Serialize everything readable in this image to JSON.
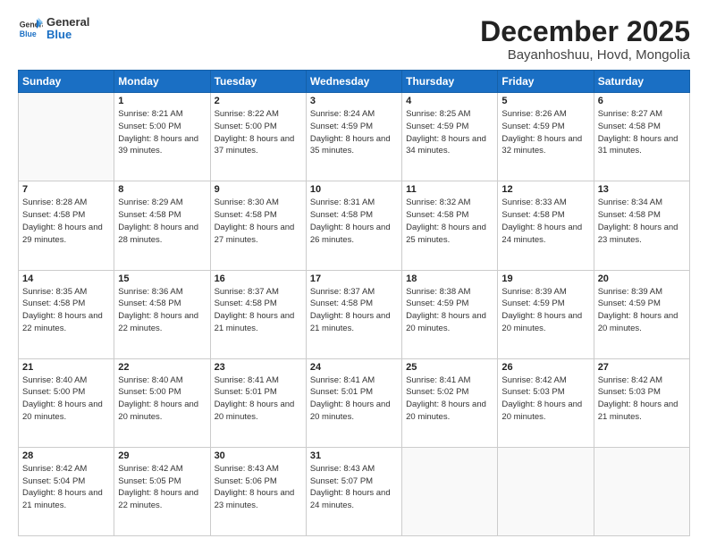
{
  "header": {
    "logo": {
      "general": "General",
      "blue": "Blue"
    },
    "title": "December 2025",
    "location": "Bayanhoshuu, Hovd, Mongolia"
  },
  "calendar": {
    "weekdays": [
      "Sunday",
      "Monday",
      "Tuesday",
      "Wednesday",
      "Thursday",
      "Friday",
      "Saturday"
    ],
    "weeks": [
      [
        {
          "day": "",
          "sunrise": "",
          "sunset": "",
          "daylight": ""
        },
        {
          "day": "1",
          "sunrise": "Sunrise: 8:21 AM",
          "sunset": "Sunset: 5:00 PM",
          "daylight": "Daylight: 8 hours and 39 minutes."
        },
        {
          "day": "2",
          "sunrise": "Sunrise: 8:22 AM",
          "sunset": "Sunset: 5:00 PM",
          "daylight": "Daylight: 8 hours and 37 minutes."
        },
        {
          "day": "3",
          "sunrise": "Sunrise: 8:24 AM",
          "sunset": "Sunset: 4:59 PM",
          "daylight": "Daylight: 8 hours and 35 minutes."
        },
        {
          "day": "4",
          "sunrise": "Sunrise: 8:25 AM",
          "sunset": "Sunset: 4:59 PM",
          "daylight": "Daylight: 8 hours and 34 minutes."
        },
        {
          "day": "5",
          "sunrise": "Sunrise: 8:26 AM",
          "sunset": "Sunset: 4:59 PM",
          "daylight": "Daylight: 8 hours and 32 minutes."
        },
        {
          "day": "6",
          "sunrise": "Sunrise: 8:27 AM",
          "sunset": "Sunset: 4:58 PM",
          "daylight": "Daylight: 8 hours and 31 minutes."
        }
      ],
      [
        {
          "day": "7",
          "sunrise": "Sunrise: 8:28 AM",
          "sunset": "Sunset: 4:58 PM",
          "daylight": "Daylight: 8 hours and 29 minutes."
        },
        {
          "day": "8",
          "sunrise": "Sunrise: 8:29 AM",
          "sunset": "Sunset: 4:58 PM",
          "daylight": "Daylight: 8 hours and 28 minutes."
        },
        {
          "day": "9",
          "sunrise": "Sunrise: 8:30 AM",
          "sunset": "Sunset: 4:58 PM",
          "daylight": "Daylight: 8 hours and 27 minutes."
        },
        {
          "day": "10",
          "sunrise": "Sunrise: 8:31 AM",
          "sunset": "Sunset: 4:58 PM",
          "daylight": "Daylight: 8 hours and 26 minutes."
        },
        {
          "day": "11",
          "sunrise": "Sunrise: 8:32 AM",
          "sunset": "Sunset: 4:58 PM",
          "daylight": "Daylight: 8 hours and 25 minutes."
        },
        {
          "day": "12",
          "sunrise": "Sunrise: 8:33 AM",
          "sunset": "Sunset: 4:58 PM",
          "daylight": "Daylight: 8 hours and 24 minutes."
        },
        {
          "day": "13",
          "sunrise": "Sunrise: 8:34 AM",
          "sunset": "Sunset: 4:58 PM",
          "daylight": "Daylight: 8 hours and 23 minutes."
        }
      ],
      [
        {
          "day": "14",
          "sunrise": "Sunrise: 8:35 AM",
          "sunset": "Sunset: 4:58 PM",
          "daylight": "Daylight: 8 hours and 22 minutes."
        },
        {
          "day": "15",
          "sunrise": "Sunrise: 8:36 AM",
          "sunset": "Sunset: 4:58 PM",
          "daylight": "Daylight: 8 hours and 22 minutes."
        },
        {
          "day": "16",
          "sunrise": "Sunrise: 8:37 AM",
          "sunset": "Sunset: 4:58 PM",
          "daylight": "Daylight: 8 hours and 21 minutes."
        },
        {
          "day": "17",
          "sunrise": "Sunrise: 8:37 AM",
          "sunset": "Sunset: 4:58 PM",
          "daylight": "Daylight: 8 hours and 21 minutes."
        },
        {
          "day": "18",
          "sunrise": "Sunrise: 8:38 AM",
          "sunset": "Sunset: 4:59 PM",
          "daylight": "Daylight: 8 hours and 20 minutes."
        },
        {
          "day": "19",
          "sunrise": "Sunrise: 8:39 AM",
          "sunset": "Sunset: 4:59 PM",
          "daylight": "Daylight: 8 hours and 20 minutes."
        },
        {
          "day": "20",
          "sunrise": "Sunrise: 8:39 AM",
          "sunset": "Sunset: 4:59 PM",
          "daylight": "Daylight: 8 hours and 20 minutes."
        }
      ],
      [
        {
          "day": "21",
          "sunrise": "Sunrise: 8:40 AM",
          "sunset": "Sunset: 5:00 PM",
          "daylight": "Daylight: 8 hours and 20 minutes."
        },
        {
          "day": "22",
          "sunrise": "Sunrise: 8:40 AM",
          "sunset": "Sunset: 5:00 PM",
          "daylight": "Daylight: 8 hours and 20 minutes."
        },
        {
          "day": "23",
          "sunrise": "Sunrise: 8:41 AM",
          "sunset": "Sunset: 5:01 PM",
          "daylight": "Daylight: 8 hours and 20 minutes."
        },
        {
          "day": "24",
          "sunrise": "Sunrise: 8:41 AM",
          "sunset": "Sunset: 5:01 PM",
          "daylight": "Daylight: 8 hours and 20 minutes."
        },
        {
          "day": "25",
          "sunrise": "Sunrise: 8:41 AM",
          "sunset": "Sunset: 5:02 PM",
          "daylight": "Daylight: 8 hours and 20 minutes."
        },
        {
          "day": "26",
          "sunrise": "Sunrise: 8:42 AM",
          "sunset": "Sunset: 5:03 PM",
          "daylight": "Daylight: 8 hours and 20 minutes."
        },
        {
          "day": "27",
          "sunrise": "Sunrise: 8:42 AM",
          "sunset": "Sunset: 5:03 PM",
          "daylight": "Daylight: 8 hours and 21 minutes."
        }
      ],
      [
        {
          "day": "28",
          "sunrise": "Sunrise: 8:42 AM",
          "sunset": "Sunset: 5:04 PM",
          "daylight": "Daylight: 8 hours and 21 minutes."
        },
        {
          "day": "29",
          "sunrise": "Sunrise: 8:42 AM",
          "sunset": "Sunset: 5:05 PM",
          "daylight": "Daylight: 8 hours and 22 minutes."
        },
        {
          "day": "30",
          "sunrise": "Sunrise: 8:43 AM",
          "sunset": "Sunset: 5:06 PM",
          "daylight": "Daylight: 8 hours and 23 minutes."
        },
        {
          "day": "31",
          "sunrise": "Sunrise: 8:43 AM",
          "sunset": "Sunset: 5:07 PM",
          "daylight": "Daylight: 8 hours and 24 minutes."
        },
        {
          "day": "",
          "sunrise": "",
          "sunset": "",
          "daylight": ""
        },
        {
          "day": "",
          "sunrise": "",
          "sunset": "",
          "daylight": ""
        },
        {
          "day": "",
          "sunrise": "",
          "sunset": "",
          "daylight": ""
        }
      ]
    ]
  }
}
